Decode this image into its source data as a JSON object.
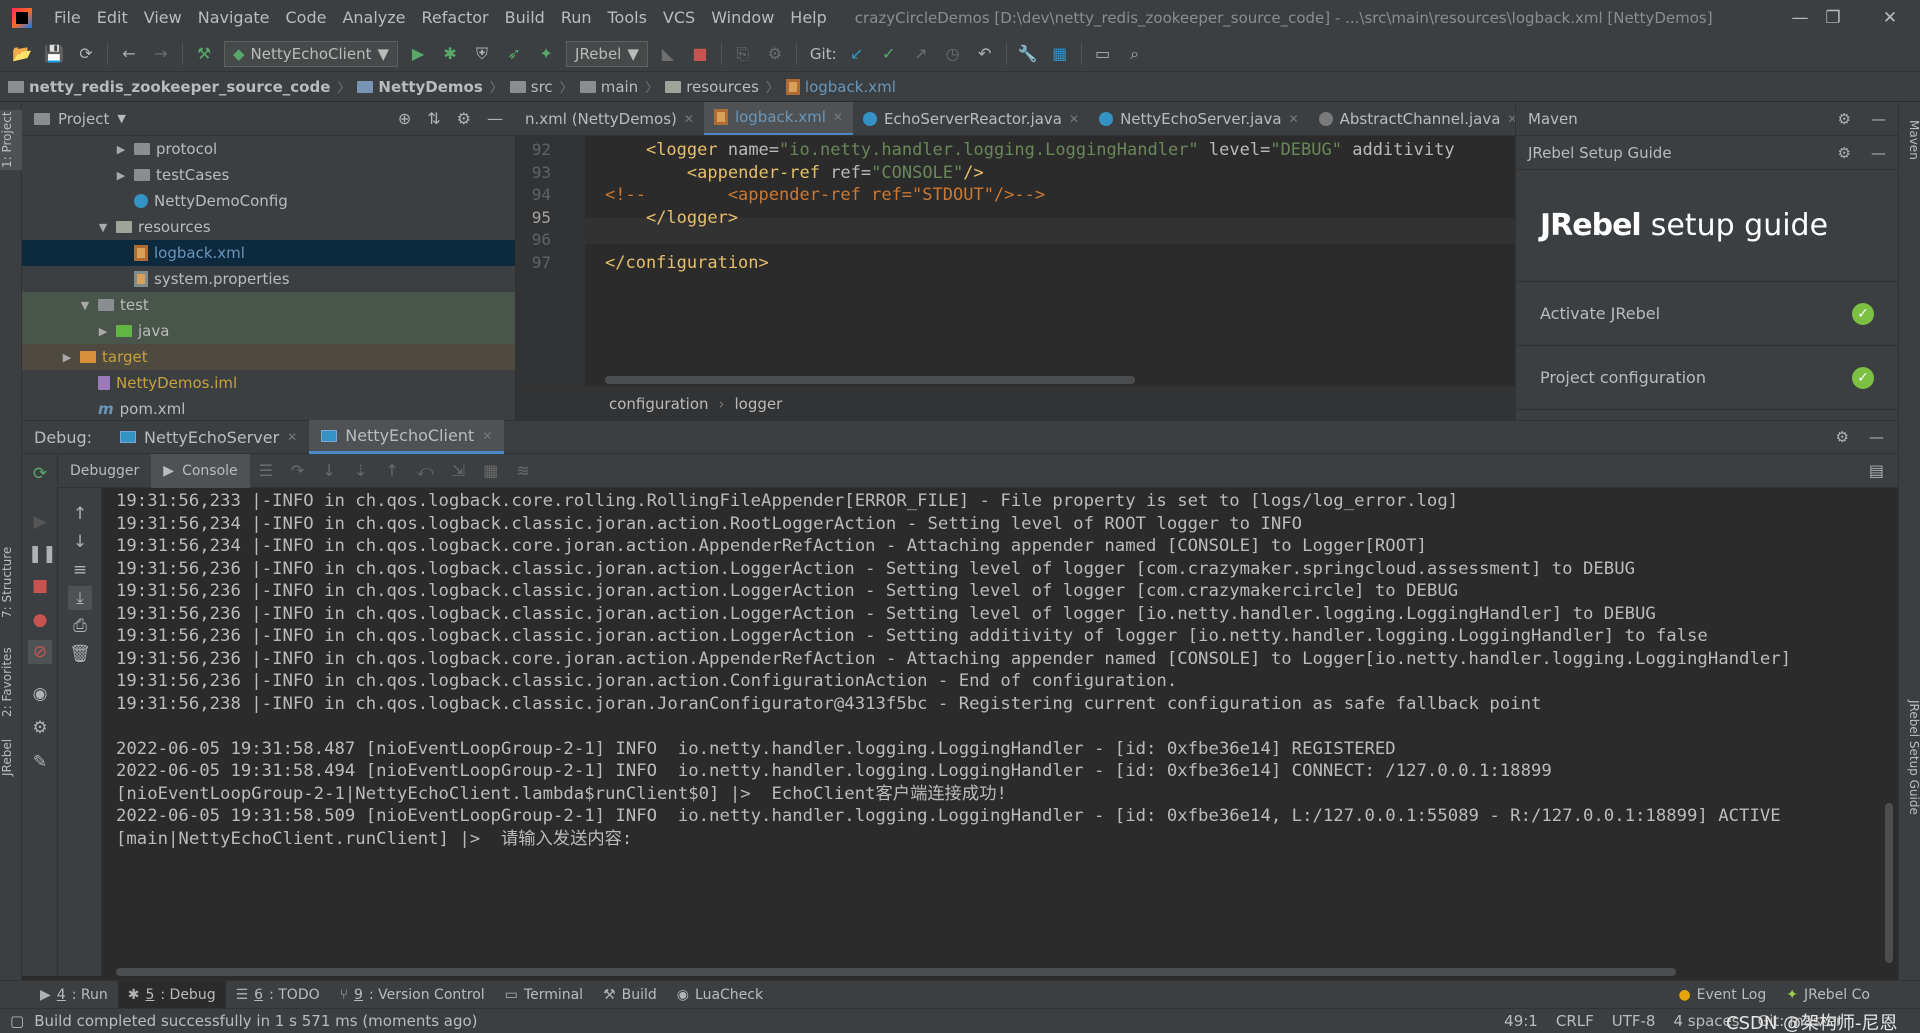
{
  "menubar": {
    "items": [
      "File",
      "Edit",
      "View",
      "Navigate",
      "Code",
      "Analyze",
      "Refactor",
      "Build",
      "Run",
      "Tools",
      "VCS",
      "Window",
      "Help"
    ],
    "window_title": "crazyCircleDemos [D:\\dev\\netty_redis_zookeeper_source_code] - ...\\src\\main\\resources\\logback.xml [NettyDemos]",
    "minimize": "—",
    "restore": "❐",
    "close": "✕"
  },
  "toolbar": {
    "run_config": "NettyEchoClient",
    "jrebel_config": "JRebel",
    "git_label": "Git:"
  },
  "breadcrumb": [
    "netty_redis_zookeeper_source_code",
    "NettyDemos",
    "src",
    "main",
    "resources",
    "logback.xml"
  ],
  "project": {
    "title": "Project",
    "tree": [
      {
        "label": "protocol",
        "indent": 5,
        "arrow": "▶",
        "icon": "folder"
      },
      {
        "label": "testCases",
        "indent": 5,
        "arrow": "▶",
        "icon": "folder"
      },
      {
        "label": "NettyDemoConfig",
        "indent": 5,
        "arrow": "",
        "icon": "java"
      },
      {
        "label": "resources",
        "indent": 4,
        "arrow": "▼",
        "icon": "res"
      },
      {
        "label": "logback.xml",
        "indent": 5,
        "arrow": "",
        "icon": "xml"
      },
      {
        "label": "system.properties",
        "indent": 5,
        "arrow": "",
        "icon": "props"
      },
      {
        "label": "test",
        "indent": 3,
        "arrow": "▼",
        "icon": "folder"
      },
      {
        "label": "java",
        "indent": 4,
        "arrow": "▶",
        "icon": "green"
      },
      {
        "label": "target",
        "indent": 2,
        "arrow": "▶",
        "icon": "orange"
      },
      {
        "label": "NettyDemos.iml",
        "indent": 3,
        "arrow": "",
        "icon": "iml"
      },
      {
        "label": "pom.xml",
        "indent": 3,
        "arrow": "",
        "icon": "pom"
      }
    ]
  },
  "editor": {
    "tabs": [
      {
        "label": "n.xml (NettyDemos)",
        "active": false,
        "icon": "xml"
      },
      {
        "label": "logback.xml",
        "active": true,
        "icon": "xml"
      },
      {
        "label": "EchoServerReactor.java",
        "active": false,
        "icon": "java"
      },
      {
        "label": "NettyEchoServer.java",
        "active": false,
        "icon": "java"
      },
      {
        "label": "AbstractChannel.java",
        "active": false,
        "icon": "jar"
      }
    ],
    "tab_overflow": "6",
    "lines": [
      {
        "num": "92",
        "tag_open": "<logger ",
        "attr1": "name=",
        "val1": "\"io.netty.handler.logging.LoggingHandler\"",
        "attr2": " level=",
        "val2": "\"DEBUG\"",
        "attr3": " additivity",
        "indent": "    "
      },
      {
        "num": "93",
        "tag_open": "<appender-ref ",
        "attr1": "ref=",
        "val1": "\"CONSOLE\"",
        "tail": "/>",
        "indent": "        "
      },
      {
        "num": "94",
        "comment": "<!--        <appender-ref ref=\"STDOUT\"/>-->"
      },
      {
        "num": "95",
        "plain": "</logger>",
        "indent": "    "
      },
      {
        "num": "96",
        "plain": ""
      },
      {
        "num": "97",
        "plain": "</configuration>"
      }
    ],
    "crumbs": [
      "configuration",
      "logger"
    ]
  },
  "maven": {
    "title": "Maven",
    "guide_title": "JRebel Setup Guide",
    "brand": "JRebel",
    "brand_tail": "setup guide",
    "items": [
      "Activate JRebel",
      "Project configuration"
    ]
  },
  "debug": {
    "label": "Debug:",
    "tabs": [
      "NettyEchoServer",
      "NettyEchoClient"
    ],
    "sub_tabs": [
      "Debugger",
      "Console"
    ],
    "console_lines": [
      "19:31:56,233 |-INFO in ch.qos.logback.core.rolling.RollingFileAppender[ERROR_FILE] - File property is set to [logs/log_error.log]",
      "19:31:56,234 |-INFO in ch.qos.logback.classic.joran.action.RootLoggerAction - Setting level of ROOT logger to INFO",
      "19:31:56,234 |-INFO in ch.qos.logback.core.joran.action.AppenderRefAction - Attaching appender named [CONSOLE] to Logger[ROOT]",
      "19:31:56,236 |-INFO in ch.qos.logback.classic.joran.action.LoggerAction - Setting level of logger [com.crazymaker.springcloud.assessment] to DEBUG",
      "19:31:56,236 |-INFO in ch.qos.logback.classic.joran.action.LoggerAction - Setting level of logger [com.crazymakercircle] to DEBUG",
      "19:31:56,236 |-INFO in ch.qos.logback.classic.joran.action.LoggerAction - Setting level of logger [io.netty.handler.logging.LoggingHandler] to DEBUG",
      "19:31:56,236 |-INFO in ch.qos.logback.classic.joran.action.LoggerAction - Setting additivity of logger [io.netty.handler.logging.LoggingHandler] to false",
      "19:31:56,236 |-INFO in ch.qos.logback.core.joran.action.AppenderRefAction - Attaching appender named [CONSOLE] to Logger[io.netty.handler.logging.LoggingHandler]",
      "19:31:56,236 |-INFO in ch.qos.logback.classic.joran.action.ConfigurationAction - End of configuration.",
      "19:31:56,238 |-INFO in ch.qos.logback.classic.joran.JoranConfigurator@4313f5bc - Registering current configuration as safe fallback point",
      "",
      "2022-06-05 19:31:58.487 [nioEventLoopGroup-2-1] INFO  io.netty.handler.logging.LoggingHandler - [id: 0xfbe36e14] REGISTERED",
      "2022-06-05 19:31:58.494 [nioEventLoopGroup-2-1] INFO  io.netty.handler.logging.LoggingHandler - [id: 0xfbe36e14] CONNECT: /127.0.0.1:18899",
      "[nioEventLoopGroup-2-1|NettyEchoClient.lambda$runClient$0] |>  EchoClient客户端连接成功!",
      "2022-06-05 19:31:58.509 [nioEventLoopGroup-2-1] INFO  io.netty.handler.logging.LoggingHandler - [id: 0xfbe36e14, L:/127.0.0.1:55089 - R:/127.0.0.1:18899] ACTIVE",
      "[main|NettyEchoClient.runClient] |>  请输入发送内容:"
    ]
  },
  "left_strip": [
    "1: Project",
    "7: Structure",
    "2: Favorites",
    "JRebel"
  ],
  "right_strip": [
    "Maven",
    "JRebel Setup Guide"
  ],
  "tooltabs": {
    "left": [
      {
        "num": "4",
        "label": ": Run"
      },
      {
        "num": "5",
        "label": ": Debug",
        "active": true
      },
      {
        "num": "6",
        "label": ": TODO"
      },
      {
        "num": "9",
        "label": ": Version Control"
      },
      {
        "num": "",
        "label": "Terminal"
      },
      {
        "num": "",
        "label": "Build"
      },
      {
        "num": "",
        "label": "LuaCheck"
      }
    ],
    "right": [
      "Event Log",
      "JRebel Co"
    ]
  },
  "statusbar": {
    "message": "Build completed successfully in 1 s 571 ms (moments ago)",
    "position": "49:1",
    "line_sep": "CRLF",
    "encoding": "UTF-8",
    "indent": "4 spaces",
    "git": "Git: master",
    "watermark": "CSDN @架构师-尼恩"
  },
  "colors": {
    "bg": "#2b2b2b",
    "panel": "#3c3f41",
    "accent": "#4a88c7",
    "selection": "#0d293e",
    "ok_green": "#7bc043"
  }
}
